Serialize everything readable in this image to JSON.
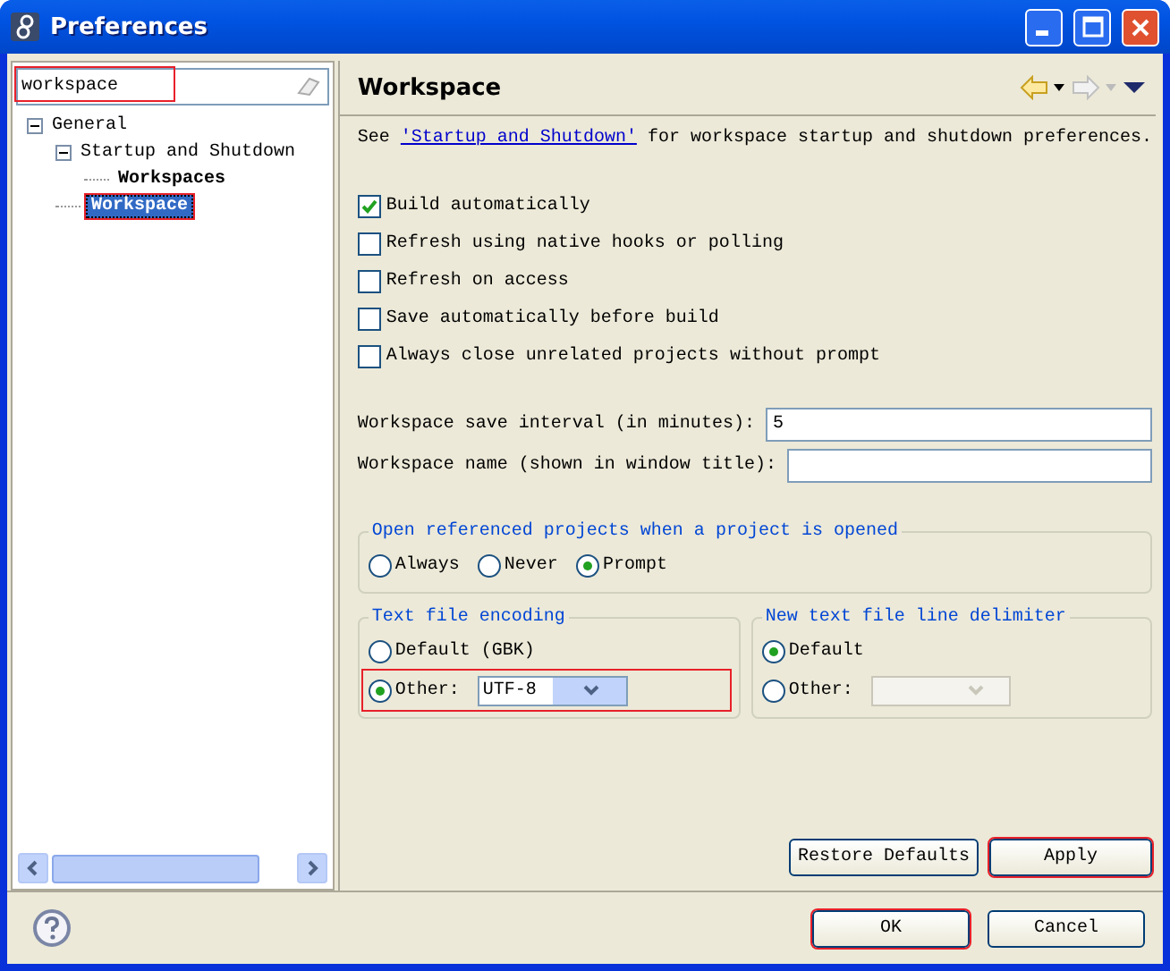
{
  "window": {
    "title": "Preferences"
  },
  "sidebar": {
    "search": {
      "value": "workspace",
      "highlighted": true
    },
    "tree": [
      {
        "label": "General",
        "expanded": true,
        "matched": false,
        "selected": false,
        "highlighted": false,
        "children": [
          {
            "label": "Startup and Shutdown",
            "expanded": true,
            "matched": false,
            "selected": false,
            "highlighted": false,
            "children": [
              {
                "label": "Workspaces",
                "matched": true,
                "selected": false,
                "highlighted": false
              }
            ]
          },
          {
            "label": "Workspace",
            "matched": true,
            "selected": true,
            "highlighted": true
          }
        ]
      }
    ]
  },
  "page": {
    "title": "Workspace",
    "intro": {
      "before": "See ",
      "link": "'Startup and Shutdown'",
      "after": " for workspace startup and shutdown preferences."
    },
    "checkboxes": [
      {
        "label": "Build automatically",
        "checked": true
      },
      {
        "label": "Refresh using native hooks or polling",
        "checked": false
      },
      {
        "label": "Refresh on access",
        "checked": false
      },
      {
        "label": "Save automatically before build",
        "checked": false
      },
      {
        "label": "Always close unrelated projects without prompt",
        "checked": false
      }
    ],
    "fields": [
      {
        "label": "Workspace save interval (in minutes):",
        "value": "5"
      },
      {
        "label": "Workspace name (shown in window title):"
      }
    ],
    "open_projects": {
      "title": "Open referenced projects when a project is opened",
      "options": [
        {
          "label": "Always",
          "selected": false
        },
        {
          "label": "Never",
          "selected": false
        },
        {
          "label": "Prompt",
          "selected": true
        }
      ]
    },
    "encoding": {
      "title": "Text file encoding",
      "options": [
        {
          "label": "Default (GBK)",
          "selected": false,
          "highlighted": false
        },
        {
          "label": "Other:",
          "selected": true,
          "highlighted": true,
          "combo": {
            "value": "UTF-8",
            "disabled": false
          }
        }
      ]
    },
    "line_delimiter": {
      "title": "New text file line delimiter",
      "options": [
        {
          "label": "Default",
          "selected": true,
          "highlighted": false
        },
        {
          "label": "Other:",
          "selected": false,
          "highlighted": false,
          "combo": {
            "disabled": true
          }
        }
      ]
    },
    "buttons": [
      {
        "label": "Restore Defaults",
        "highlighted": false
      },
      {
        "label": "Apply",
        "highlighted": true
      }
    ]
  },
  "footer": {
    "buttons": [
      {
        "label": "OK",
        "highlighted": true
      },
      {
        "label": "Cancel",
        "highlighted": false
      }
    ]
  }
}
